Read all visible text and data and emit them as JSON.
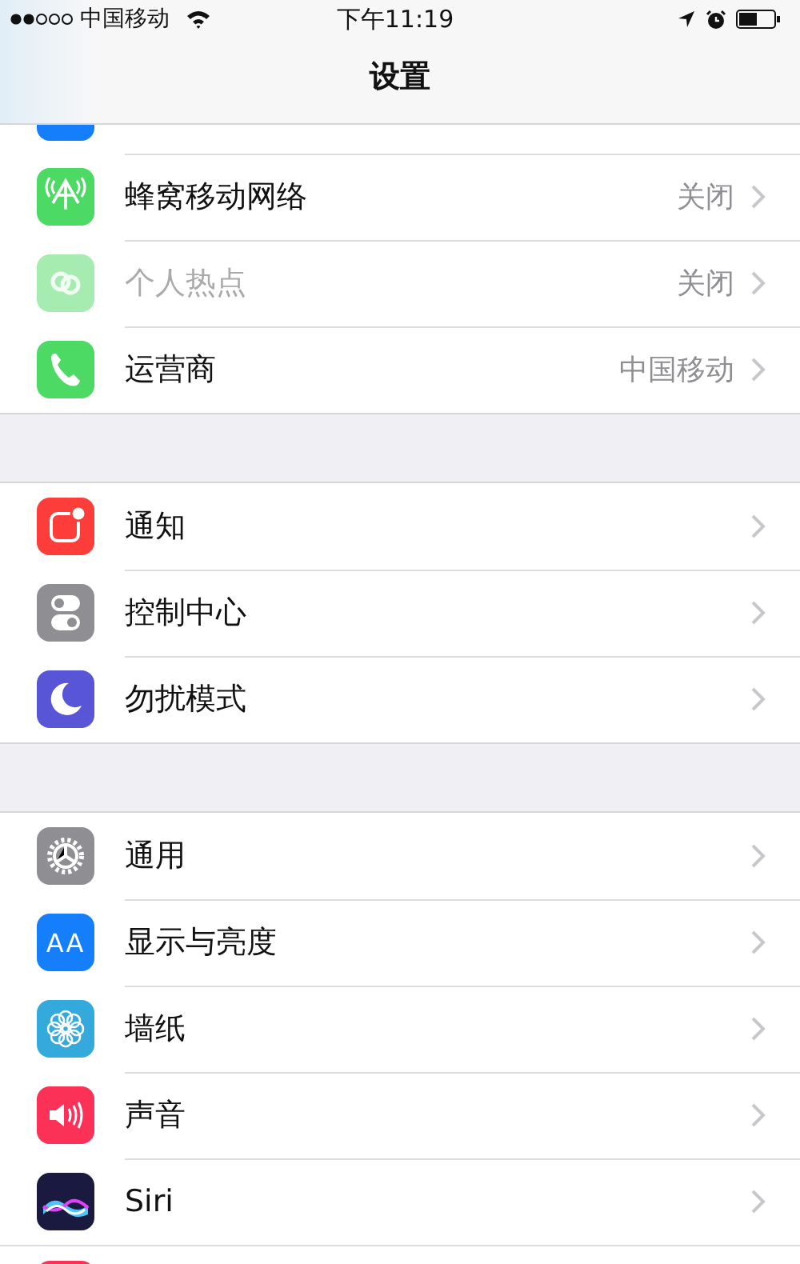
{
  "status_bar": {
    "carrier": "中国移动",
    "time": "下午11:19"
  },
  "nav_bar": {
    "title": "设置"
  },
  "groups": [
    {
      "items": [
        {
          "kind": "clipped",
          "color": "#157efb"
        },
        {
          "kind": "row",
          "label": "蜂窝移动网络",
          "value": "关闭",
          "color": "#4cd964",
          "disabled": false
        },
        {
          "kind": "row",
          "label": "个人热点",
          "value": "关闭",
          "color": "#a6ecb1",
          "disabled": true
        },
        {
          "kind": "row",
          "label": "运营商",
          "value": "中国移动",
          "color": "#4cd964",
          "disabled": false
        }
      ]
    },
    {
      "items": [
        {
          "kind": "row",
          "label": "通知",
          "color": "#fc3d39",
          "disabled": false
        },
        {
          "kind": "row",
          "label": "控制中心",
          "color": "#8e8e93",
          "disabled": false
        },
        {
          "kind": "row",
          "label": "勿扰模式",
          "color": "#5856d6",
          "disabled": false
        }
      ]
    },
    {
      "items": [
        {
          "kind": "row",
          "label": "通用",
          "color": "#8e8e93",
          "disabled": false
        },
        {
          "kind": "row",
          "label": "显示与亮度",
          "color": "#157efb",
          "icon_text": "AA",
          "disabled": false
        },
        {
          "kind": "row",
          "label": "墙纸",
          "color": "#34aadc",
          "disabled": false
        },
        {
          "kind": "row",
          "label": "声音",
          "color": "#fc3158",
          "disabled": false
        },
        {
          "kind": "row",
          "label": "Siri",
          "color": "#1a1a40",
          "disabled": false
        },
        {
          "kind": "clipped_bottom",
          "color": "#fc3158"
        }
      ]
    }
  ]
}
